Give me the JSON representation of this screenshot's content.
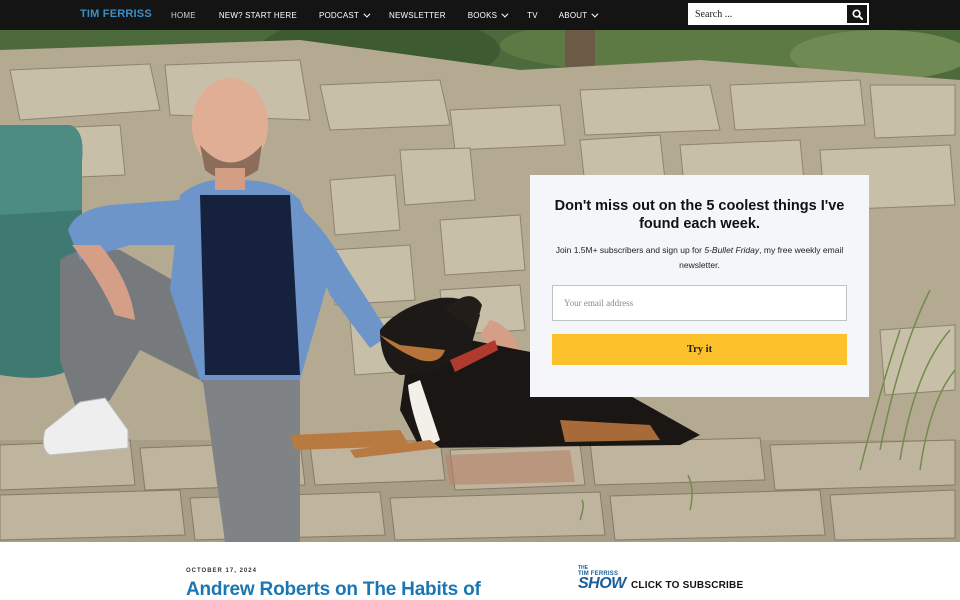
{
  "nav": {
    "logo": "TIM FERRISS",
    "items": [
      {
        "label": "HOME",
        "active": true,
        "dropdown": false
      },
      {
        "label": "NEW? START HERE",
        "active": false,
        "dropdown": false
      },
      {
        "label": "PODCAST",
        "active": false,
        "dropdown": true
      },
      {
        "label": "NEWSLETTER",
        "active": false,
        "dropdown": false
      },
      {
        "label": "BOOKS",
        "active": false,
        "dropdown": true
      },
      {
        "label": "TV",
        "active": false,
        "dropdown": false
      },
      {
        "label": "ABOUT",
        "active": false,
        "dropdown": true
      }
    ],
    "search": {
      "placeholder": "Search ...",
      "icon": "search-icon"
    }
  },
  "signup": {
    "title": "Don't miss out on the 5 coolest things I've found each week.",
    "sub_before": "Join 1.5M+ subscribers and sign up for ",
    "sub_em": "5-Bullet Friday",
    "sub_after": ", my free weekly email newsletter.",
    "email_placeholder": "Your email address",
    "button": "Try it"
  },
  "post": {
    "date": "OCTOBER 17, 2024",
    "title": "Andrew Roberts on The Habits of"
  },
  "show": {
    "logo_line1": "THE",
    "logo_line2": "TIM FERRISS",
    "logo_line3": "SHOW",
    "cta": "CLICK TO SUBSCRIBE"
  },
  "colors": {
    "nav_bg": "#141414",
    "logo": "#3d8fc7",
    "button": "#fcc12b",
    "post_title": "#1a77b3"
  }
}
